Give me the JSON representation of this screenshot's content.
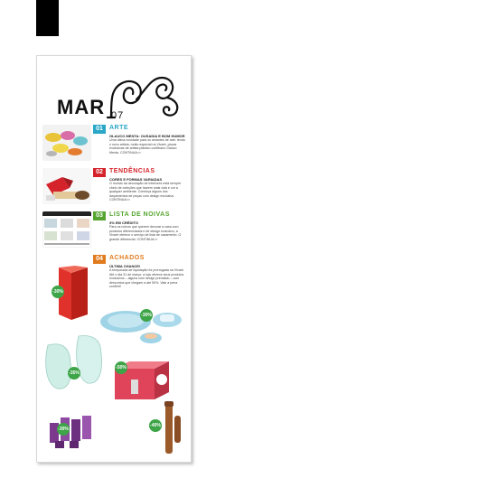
{
  "header": {
    "mar": "MAR",
    "issue": "07"
  },
  "sections": [
    {
      "badge": "01",
      "title": "ARTE",
      "subtitle": "GLAUCO MENTA: OUSADIA E BOM HUMOR",
      "body": "Uma ótima novidade para os amantes de arte: tendo o novo artista, muito especial na Vivaré, peças exclusivas de artista plástico curitibano Glauco Menta. CONTINUA>>",
      "color": "#2aa7c7"
    },
    {
      "badge": "02",
      "title": "TENDÊNCIAS",
      "subtitle": "CORES E FORMAS VARIADAS",
      "body": "O mundo da decoração de interiores está sempre cheio de coleções que trazem mais vida e cor a qualquer ambiente. Conheça alguns dos lançamentos de peças com design exclusivo. CONTINUA>>",
      "color": "#d4232b"
    },
    {
      "badge": "03",
      "title": "LISTA DE NOIVAS",
      "subtitle": "3% EM CRÉDITO",
      "body": "Para os noivos que querem decorar a casa com produtos diferenciados e de design exclusivo, a Vivaré oferece o serviço de lista de casamento. O grande diferencial. CONTINUA>>",
      "color": "#56a531"
    },
    {
      "badge": "04",
      "title": "ACHADOS",
      "subtitle": "ÚLTIMA CHANCE!",
      "body": "A temporada de liquidação foi prorrogada na Vivaré. Até o dia 31 de março, a loja oferece seus produtos exclusivos – alguns com design premiado – com descontos que chegam a até 50%. Vale a pena conferir!",
      "color": "#e07b1f"
    }
  ],
  "discounts": [
    "-30%",
    "-30%",
    "-35%",
    "-50%",
    "-30%",
    "-40%"
  ]
}
